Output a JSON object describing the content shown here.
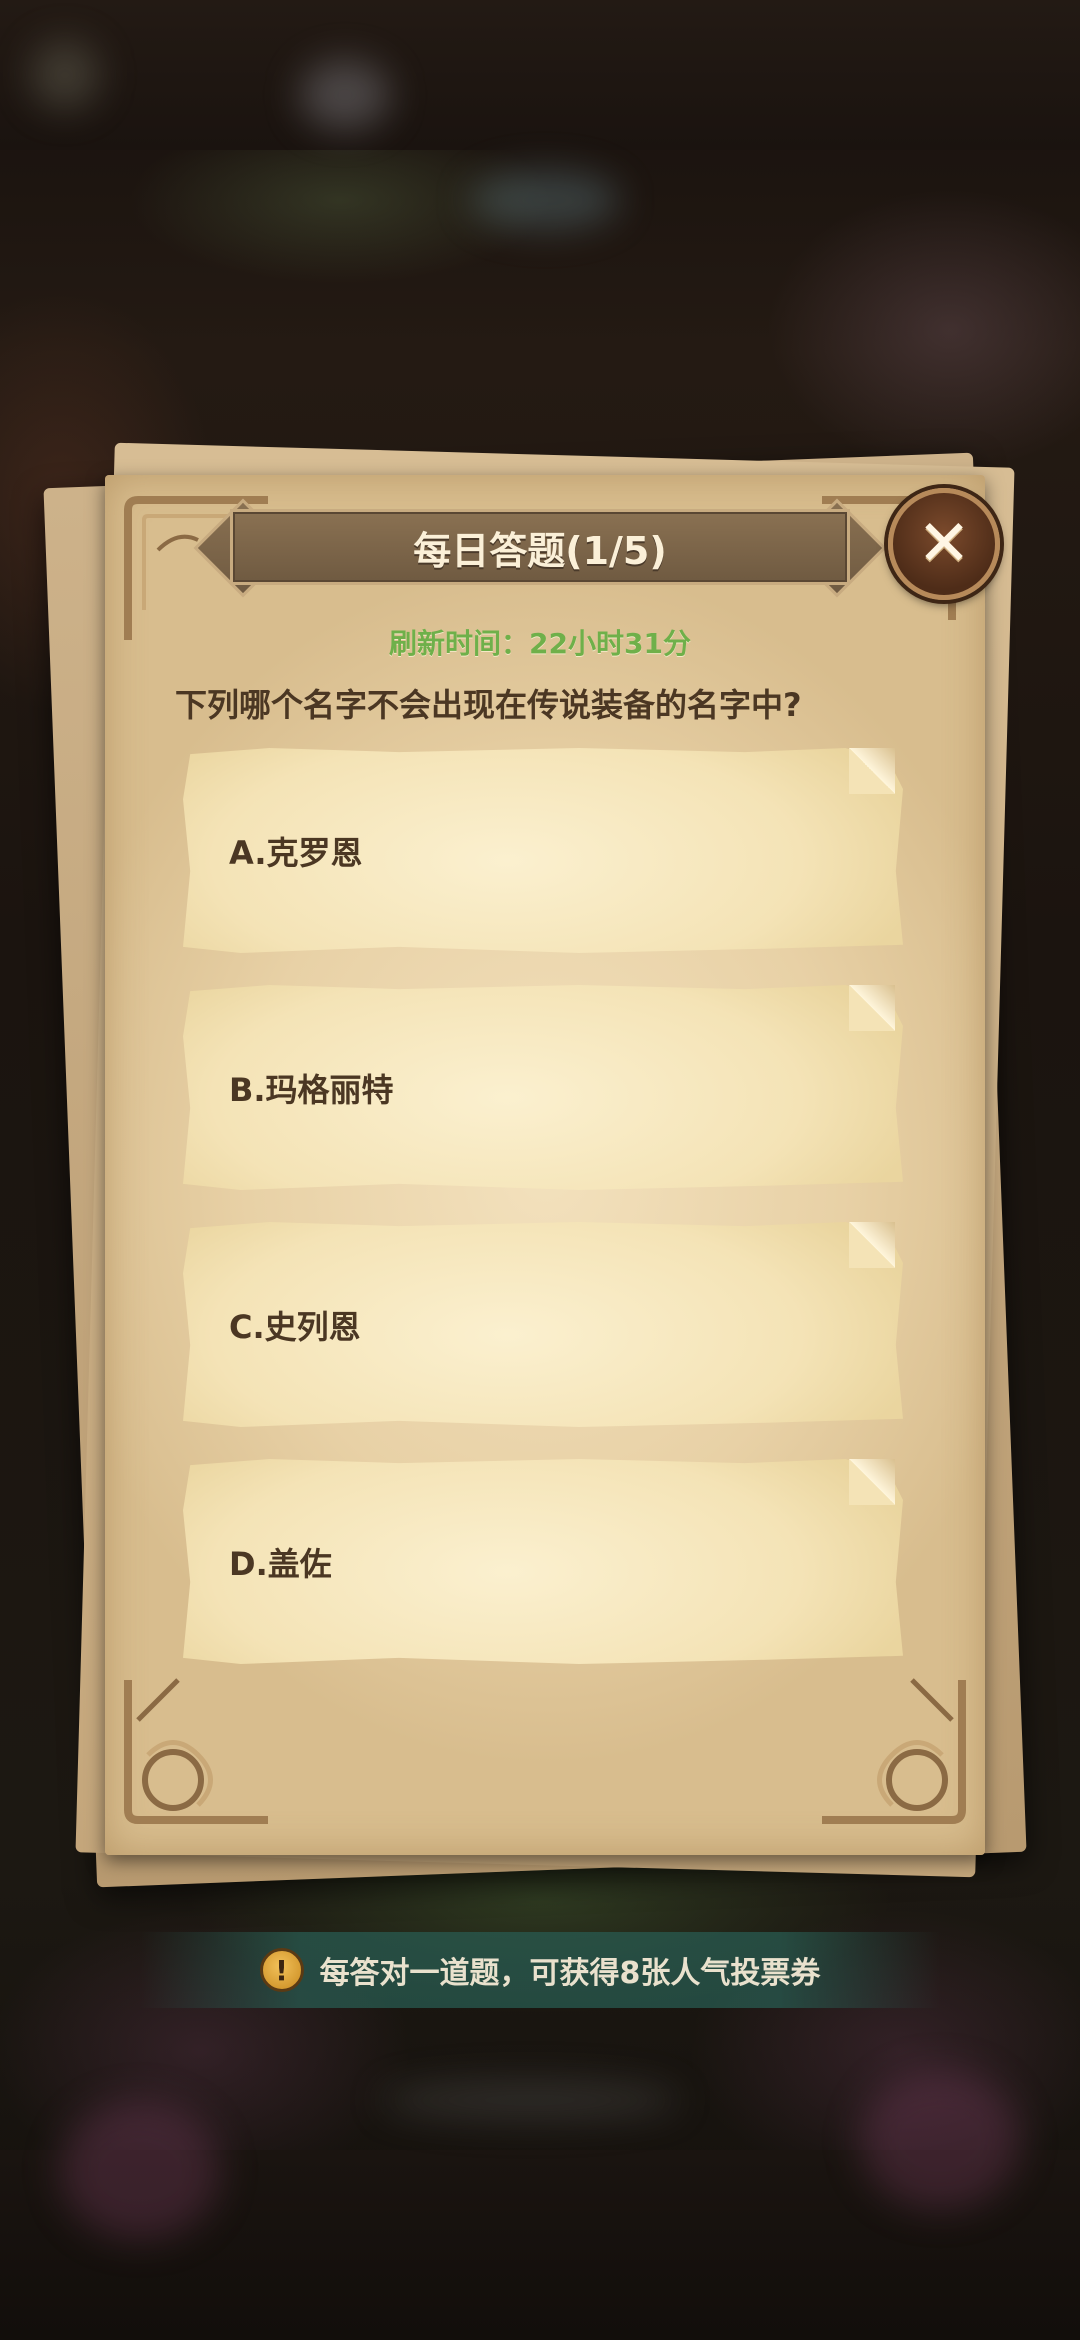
{
  "dialog": {
    "title": "每日答题(1/5)",
    "close_icon": "close-x-icon",
    "refresh_label": "刷新时间：",
    "refresh_time": "22小时31分",
    "question": "下列哪个名字不会出现在传说装备的名字中?"
  },
  "options": [
    {
      "label": "A.克罗恩"
    },
    {
      "label": "B.玛格丽特"
    },
    {
      "label": "C.史列恩"
    },
    {
      "label": "D.盖佐"
    }
  ],
  "tip": {
    "icon": "exclamation-icon",
    "icon_glyph": "!",
    "text": "每答对一道题，可获得8张人气投票券"
  },
  "colors": {
    "paper": "#f3e1bd",
    "banner": "#7a6349",
    "refresh_green": "#6fb04a",
    "text_brown": "#4b3723"
  }
}
